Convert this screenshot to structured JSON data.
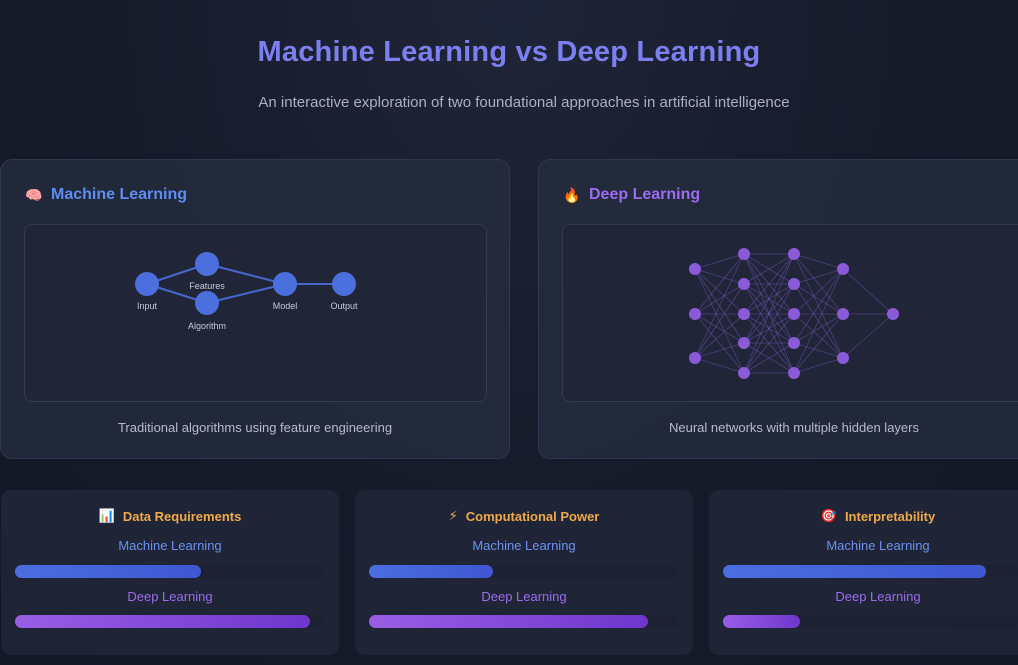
{
  "header": {
    "title": "Machine Learning vs Deep Learning",
    "subtitle": "An interactive exploration of two foundational approaches in artificial intelligence"
  },
  "cards": {
    "ml": {
      "icon": "brain-icon",
      "emoji": "🧠",
      "title": "Machine Learning",
      "description": "Traditional algorithms using feature engineering",
      "nodes": {
        "input": "Input",
        "features": "Features",
        "algorithm": "Algorithm",
        "model": "Model",
        "output": "Output"
      }
    },
    "dl": {
      "icon": "fire-icon",
      "emoji": "🔥",
      "title": "Deep Learning",
      "description": "Neural networks with multiple hidden layers"
    }
  },
  "metrics": [
    {
      "icon": "bar-chart-icon",
      "emoji": "📊",
      "title": "Data Requirements",
      "ml_label": "Machine Learning",
      "dl_label": "Deep Learning",
      "ml_level": 0.6,
      "dl_level": 0.95
    },
    {
      "icon": "lightning-icon",
      "emoji": "⚡",
      "title": "Computational Power",
      "ml_label": "Machine Learning",
      "dl_label": "Deep Learning",
      "ml_level": 0.4,
      "dl_level": 0.9
    },
    {
      "icon": "target-icon",
      "emoji": "🎯",
      "title": "Interpretability",
      "ml_label": "Machine Learning",
      "dl_label": "Deep Learning",
      "ml_level": 0.89,
      "dl_level": 0.26
    }
  ],
  "colors": {
    "title": "#7b7ff0",
    "ml_accent": "#5f8cf0",
    "dl_accent": "#9c6cf0",
    "metric_title": "#f0a94a",
    "ml_node": "#4b6fdc",
    "dl_node": "#8b5ad8"
  }
}
